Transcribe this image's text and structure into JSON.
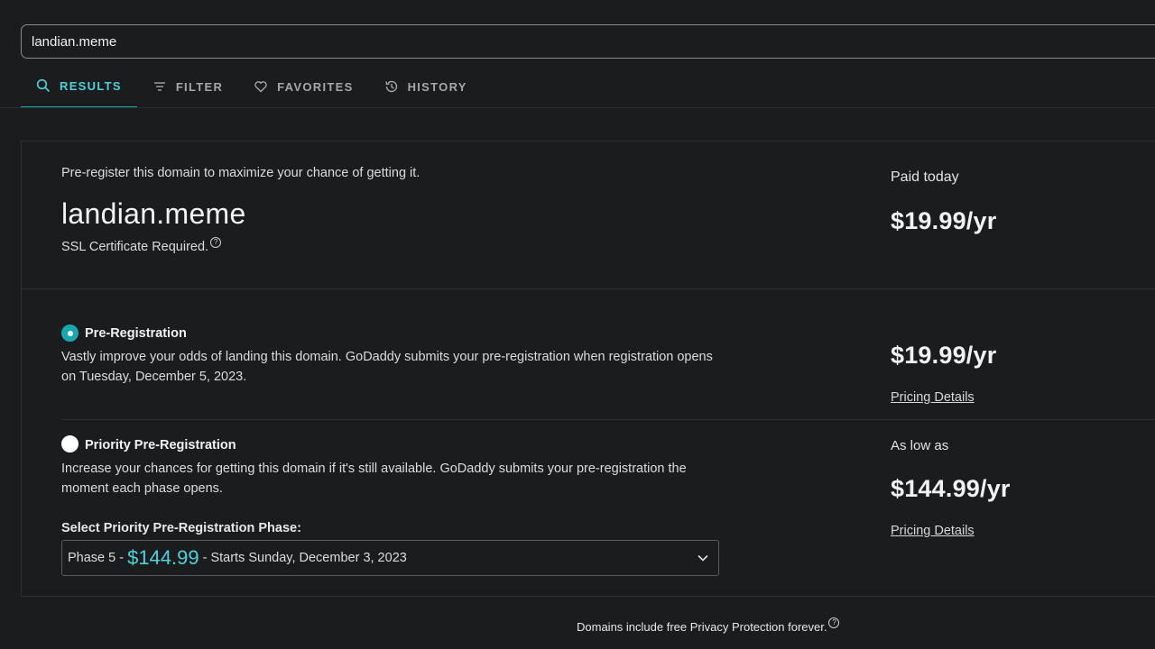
{
  "search": {
    "value": "landian.meme"
  },
  "tabs": [
    {
      "label": "RESULTS",
      "icon": "search-icon",
      "active": true
    },
    {
      "label": "FILTER",
      "icon": "filter-icon",
      "active": false
    },
    {
      "label": "FAVORITES",
      "icon": "heart-icon",
      "active": false
    },
    {
      "label": "HISTORY",
      "icon": "history-icon",
      "active": false
    }
  ],
  "summary": {
    "hint": "Pre-register this domain to maximize your chance of getting it.",
    "domain": "landian.meme",
    "ssl_note": "SSL Certificate Required.",
    "paid_label": "Paid today",
    "paid_price": "$19.99/yr"
  },
  "options": [
    {
      "title": "Pre-Registration",
      "selected": true,
      "description": "Vastly improve your odds of landing this domain. GoDaddy submits your pre-registration when registration opens on Tuesday, December 5, 2023.",
      "price": "$19.99/yr",
      "pricing_link": "Pricing Details"
    },
    {
      "title": "Priority Pre-Registration",
      "selected": false,
      "description": "Increase your chances for getting this domain if it's still available. GoDaddy submits your pre-registration the moment each phase opens.",
      "price_prefix": "As low as",
      "price": "$144.99/yr",
      "pricing_link": "Pricing Details",
      "phase_select_label": "Select Priority Pre-Registration Phase:",
      "phase_selected": {
        "prefix": "Phase 5 -",
        "price": "$144.99",
        "suffix": "- Starts Sunday, December 3, 2023"
      }
    }
  ],
  "footer": {
    "note": "Domains include free Privacy Protection forever."
  },
  "colors": {
    "accent": "#1aa8b0",
    "accent_text": "#4dd2dc",
    "background": "#1b1c1e"
  }
}
